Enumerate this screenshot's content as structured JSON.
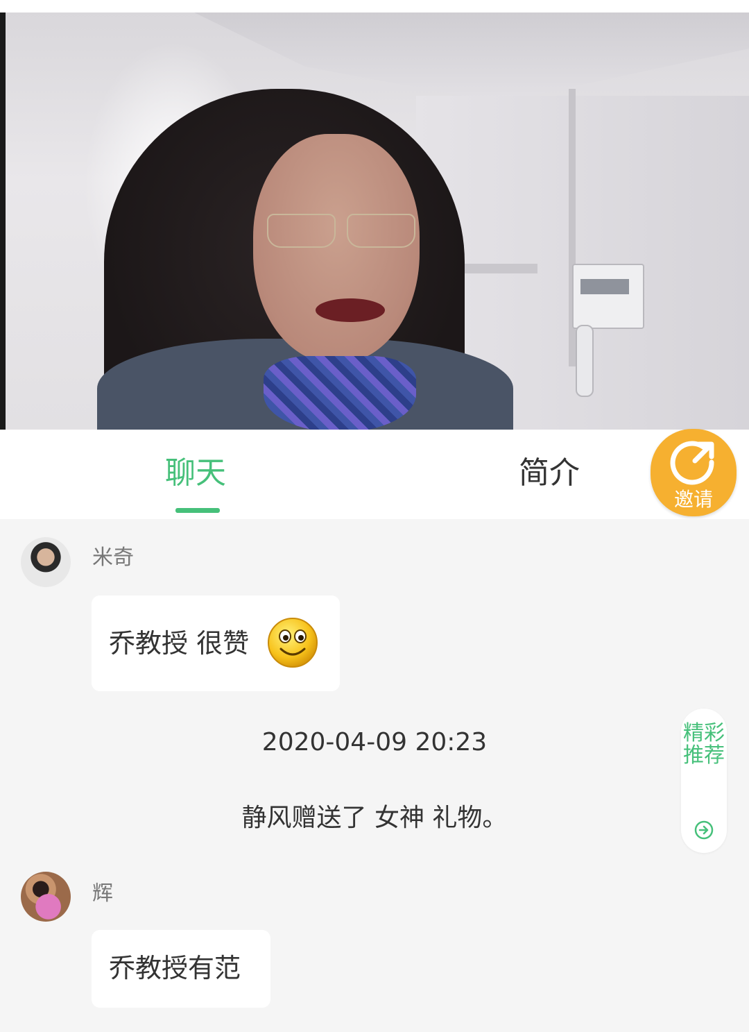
{
  "tabs": {
    "chat_label": "聊天",
    "intro_label": "简介"
  },
  "invite": {
    "label": "邀请",
    "icon": "share-icon"
  },
  "messages": [
    {
      "username": "米奇",
      "text": "乔教授 很赞",
      "emoji": "smiley-emoji-icon"
    },
    {
      "username": "辉",
      "text": "乔教授有范"
    }
  ],
  "timestamp": "2020-04-09 20:23",
  "system_message": "静风赠送了 女神 礼物。",
  "recommend": {
    "label": "精彩推荐",
    "icon": "arrow-right-circle-icon"
  },
  "colors": {
    "accent_green": "#46c07a",
    "invite_orange": "#f6b030",
    "chat_background": "#f5f5f5"
  }
}
